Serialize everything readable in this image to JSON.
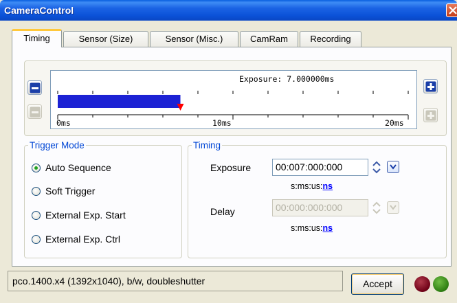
{
  "window": {
    "title": "CameraControl"
  },
  "tabs": [
    {
      "label": "Timing",
      "active": true
    },
    {
      "label": "Sensor (Size)",
      "active": false
    },
    {
      "label": "Sensor (Misc.)",
      "active": false
    },
    {
      "label": "CamRam",
      "active": false
    },
    {
      "label": "Recording",
      "active": false
    }
  ],
  "scale": {
    "exposure_label": "Exposure: 7.000000ms",
    "exposure_value_ms": 7.0,
    "range_ms": [
      0,
      20
    ],
    "tick_labels": [
      "0ms",
      "10ms",
      "20ms"
    ],
    "bar_color": "#1c22d4",
    "marker_color": "#ff0000"
  },
  "trigger_mode": {
    "legend": "Trigger Mode",
    "options": [
      {
        "label": "Auto Sequence",
        "checked": true
      },
      {
        "label": "Soft Trigger",
        "checked": false
      },
      {
        "label": "External Exp. Start",
        "checked": false
      },
      {
        "label": "External Exp. Ctrl",
        "checked": false
      }
    ]
  },
  "timing": {
    "legend": "Timing",
    "exposure": {
      "label": "Exposure",
      "value": "00:007:000:000",
      "units_prefix": "s:ms:us:",
      "units_highlight": "ns",
      "enabled": true
    },
    "delay": {
      "label": "Delay",
      "value": "00:000:000:000",
      "units_prefix": "s:ms:us:",
      "units_highlight": "ns",
      "enabled": false
    }
  },
  "status": {
    "text": "pco.1400.x4 (1392x1040), b/w, doubleshutter"
  },
  "accept_button": {
    "label": "Accept"
  },
  "leds": {
    "red": "#6e0016",
    "green": "#2d7d12"
  }
}
